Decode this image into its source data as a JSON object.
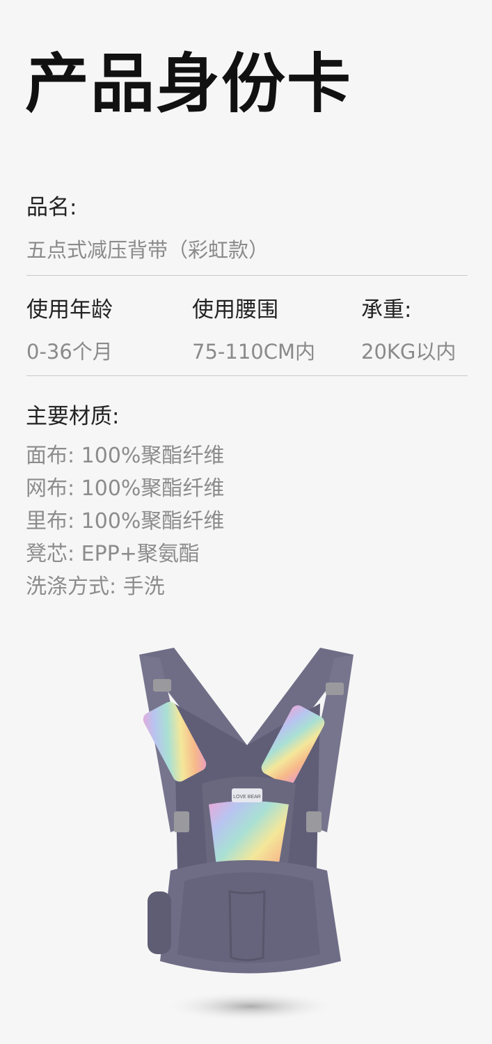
{
  "header": {
    "title": "产品身份卡"
  },
  "name": {
    "label": "品名:",
    "value": "五点式减压背带（彩虹款）"
  },
  "specs": [
    {
      "label": "使用年龄",
      "value": "0-36个月"
    },
    {
      "label": "使用腰围",
      "value": "75-110CM内"
    },
    {
      "label": "承重:",
      "value": "20KG以内"
    }
  ],
  "materials": {
    "label": "主要材质:",
    "lines": [
      "面布: 100%聚酯纤维",
      "网布: 100%聚酯纤维",
      "里布: 100%聚酯纤维",
      "凳芯: EPP+聚氨酯",
      "洗涤方式: 手洗"
    ]
  },
  "product_image": {
    "name": "baby-carrier-hip-seat",
    "colors": {
      "body": "#6f6d86",
      "body_dark": "#57566b",
      "buckle": "#9a9a9e"
    },
    "badge_text": "LOVE BEAR"
  }
}
